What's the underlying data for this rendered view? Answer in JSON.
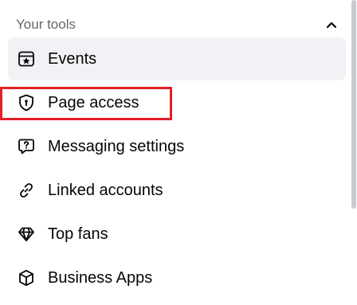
{
  "section": {
    "title": "Your tools",
    "collapse_icon": "chevron-up-icon"
  },
  "items": [
    {
      "label": "Events",
      "icon": "calendar-star-icon",
      "active": true
    },
    {
      "label": "Page access",
      "icon": "shield-keyhole-icon",
      "highlighted": true
    },
    {
      "label": "Messaging settings",
      "icon": "chat-question-icon"
    },
    {
      "label": "Linked accounts",
      "icon": "link-icon"
    },
    {
      "label": "Top fans",
      "icon": "diamond-icon"
    },
    {
      "label": "Business Apps",
      "icon": "cube-icon"
    }
  ],
  "colors": {
    "highlight": "#e41e26",
    "active_bg": "#f0f2f5",
    "muted_text": "#65676b"
  }
}
